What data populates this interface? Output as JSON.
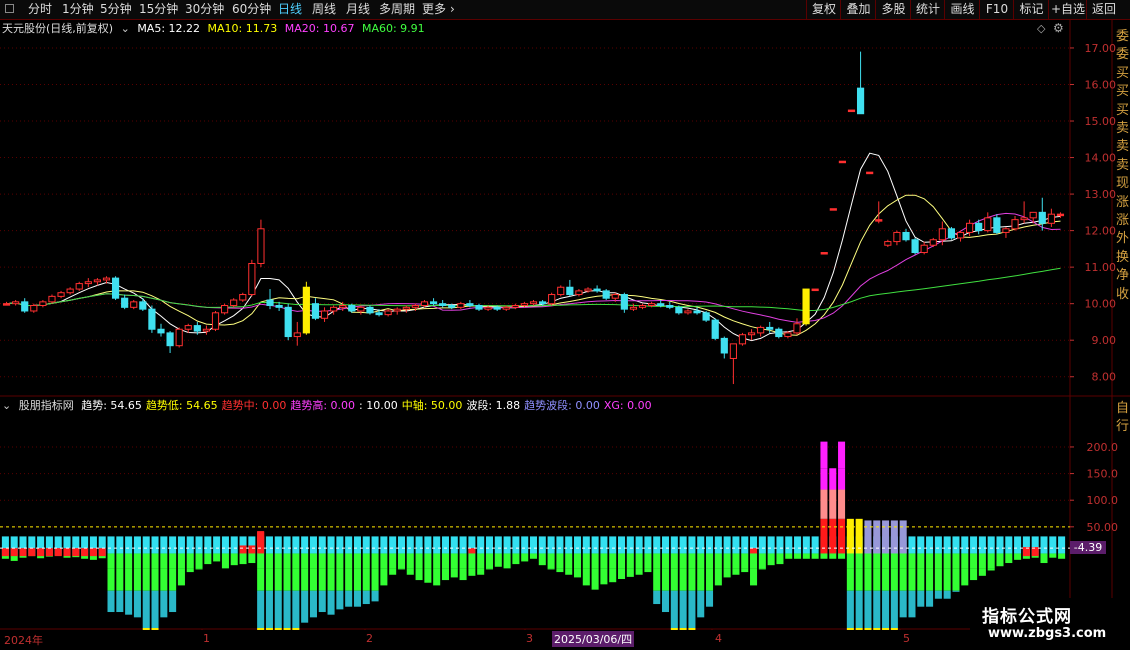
{
  "toolbar": {
    "periods": [
      "分时",
      "1分钟",
      "5分钟",
      "15分钟",
      "30分钟",
      "60分钟",
      "日线",
      "周线",
      "月线",
      "多周期",
      "更多"
    ],
    "active_period": "日线",
    "right_buttons": [
      "复权",
      "叠加",
      "多股",
      "统计",
      "画线",
      "F10",
      "标记",
      "+自选",
      "返回"
    ]
  },
  "main_info": {
    "stock": "天元股份(日线,前复权)",
    "ma5": "MA5: 12.22",
    "ma10": "MA10: 11.73",
    "ma20": "MA20: 10.67",
    "ma60": "MA60: 9.91"
  },
  "indicator_info": {
    "name": "股朋指标网",
    "items": [
      {
        "text": "趋势: 54.65",
        "color": "#ffffff"
      },
      {
        "text": "趋势低: 54.65",
        "color": "#ffff00"
      },
      {
        "text": "趋势中: 0.00",
        "color": "#ff3030"
      },
      {
        "text": "趋势高: 0.00",
        "color": "#ff40ff"
      },
      {
        "text": ": 10.00",
        "color": "#ffffff"
      },
      {
        "text": "中轴: 50.00",
        "color": "#ffff00"
      },
      {
        "text": "波段: 1.88",
        "color": "#ffffff"
      },
      {
        "text": "趋势波段: 0.00",
        "color": "#9090ff"
      },
      {
        "text": "XG: 0.00",
        "color": "#ff40ff"
      }
    ]
  },
  "price_axis": [
    "17.00",
    "16.00",
    "15.00",
    "14.00",
    "13.00",
    "12.00",
    "11.00",
    "10.00",
    "9.00",
    "8.00"
  ],
  "indicator_axis": [
    "200.0",
    "150.0",
    "100.0",
    "50.00"
  ],
  "indicator_value_tag": "-4.39",
  "date_axis": [
    "2024年",
    "1",
    "2",
    "3",
    "4",
    "5"
  ],
  "date_highlight": "2025/03/06/四",
  "watermark": {
    "title": "指标公式网",
    "url": "www.zbgs3.com"
  },
  "right_edge_text": [
    "委",
    "委",
    "买",
    "买",
    "买",
    "卖",
    "卖",
    "卖",
    "现",
    "涨",
    "涨",
    "外",
    "换",
    "净",
    "收"
  ],
  "right_edge_text_lower": [
    "自",
    "行"
  ],
  "colors": {
    "up": "#ff3030",
    "down": "#40e0f0",
    "limit_up": "#ffee00",
    "ma5": "#ffffff",
    "ma10": "#ffff80",
    "ma20": "#e040e0",
    "ma60": "#40e040",
    "grid": "#5a0000"
  },
  "chart_data": [
    {
      "type": "candlestick",
      "title": "天元股份(日线,前复权)",
      "ylim": [
        7.5,
        17.3
      ],
      "candles": [
        [
          10.0,
          10.05,
          9.95,
          10.0
        ],
        [
          10.0,
          10.1,
          9.95,
          10.05
        ],
        [
          10.05,
          10.15,
          9.75,
          9.8
        ],
        [
          9.8,
          10.0,
          9.75,
          9.95
        ],
        [
          9.95,
          10.1,
          9.9,
          10.05
        ],
        [
          10.05,
          10.25,
          10.0,
          10.2
        ],
        [
          10.2,
          10.35,
          10.15,
          10.3
        ],
        [
          10.3,
          10.45,
          10.25,
          10.4
        ],
        [
          10.4,
          10.6,
          10.35,
          10.55
        ],
        [
          10.55,
          10.7,
          10.45,
          10.6
        ],
        [
          10.6,
          10.7,
          10.5,
          10.65
        ],
        [
          10.65,
          10.75,
          10.55,
          10.7
        ],
        [
          10.7,
          10.75,
          10.1,
          10.15
        ],
        [
          10.15,
          10.25,
          9.85,
          9.9
        ],
        [
          9.9,
          10.1,
          9.85,
          10.05
        ],
        [
          10.05,
          10.15,
          9.8,
          9.85
        ],
        [
          9.85,
          9.95,
          9.2,
          9.3
        ],
        [
          9.3,
          9.45,
          9.1,
          9.2
        ],
        [
          9.2,
          9.25,
          8.65,
          8.85
        ],
        [
          8.85,
          9.35,
          8.8,
          9.3
        ],
        [
          9.3,
          9.45,
          9.2,
          9.4
        ],
        [
          9.4,
          9.5,
          9.15,
          9.25
        ],
        [
          9.25,
          9.4,
          9.15,
          9.3
        ],
        [
          9.3,
          9.8,
          9.25,
          9.75
        ],
        [
          9.75,
          10.0,
          9.7,
          9.95
        ],
        [
          9.95,
          10.15,
          9.9,
          10.1
        ],
        [
          10.1,
          10.3,
          10.05,
          10.25
        ],
        [
          10.25,
          11.2,
          10.2,
          11.1
        ],
        [
          11.1,
          12.3,
          11.0,
          12.05
        ],
        [
          10.1,
          10.4,
          9.85,
          9.95
        ],
        [
          9.95,
          10.05,
          9.8,
          9.9
        ],
        [
          9.9,
          10.0,
          9.0,
          9.1
        ],
        [
          9.1,
          9.5,
          8.85,
          9.2
        ],
        [
          9.2,
          10.6,
          9.15,
          10.45
        ],
        [
          10.0,
          10.15,
          9.55,
          9.6
        ],
        [
          9.6,
          9.9,
          9.5,
          9.8
        ],
        [
          9.8,
          9.95,
          9.7,
          9.9
        ],
        [
          9.9,
          10.05,
          9.8,
          9.95
        ],
        [
          9.95,
          10.0,
          9.75,
          9.8
        ],
        [
          9.8,
          9.95,
          9.7,
          9.9
        ],
        [
          9.9,
          9.95,
          9.7,
          9.75
        ],
        [
          9.75,
          9.85,
          9.65,
          9.7
        ],
        [
          9.7,
          9.85,
          9.65,
          9.8
        ],
        [
          9.8,
          9.9,
          9.7,
          9.85
        ],
        [
          9.85,
          9.95,
          9.75,
          9.9
        ],
        [
          9.9,
          10.0,
          9.8,
          9.95
        ],
        [
          9.95,
          10.1,
          9.9,
          10.05
        ],
        [
          10.05,
          10.15,
          9.95,
          10.0
        ],
        [
          10.0,
          10.1,
          9.9,
          9.95
        ],
        [
          9.95,
          10.0,
          9.85,
          9.9
        ],
        [
          9.9,
          10.05,
          9.85,
          10.0
        ],
        [
          10.0,
          10.1,
          9.9,
          9.95
        ],
        [
          9.95,
          10.0,
          9.8,
          9.85
        ],
        [
          9.85,
          9.95,
          9.8,
          9.9
        ],
        [
          9.9,
          9.95,
          9.8,
          9.85
        ],
        [
          9.85,
          9.95,
          9.8,
          9.9
        ],
        [
          9.9,
          10.0,
          9.85,
          9.95
        ],
        [
          9.95,
          10.05,
          9.9,
          10.0
        ],
        [
          10.0,
          10.1,
          9.95,
          10.05
        ],
        [
          10.05,
          10.1,
          9.95,
          10.0
        ],
        [
          10.0,
          10.3,
          9.95,
          10.25
        ],
        [
          10.25,
          10.5,
          10.2,
          10.45
        ],
        [
          10.45,
          10.65,
          10.2,
          10.25
        ],
        [
          10.25,
          10.4,
          10.2,
          10.35
        ],
        [
          10.35,
          10.45,
          10.3,
          10.4
        ],
        [
          10.4,
          10.5,
          10.3,
          10.35
        ],
        [
          10.35,
          10.4,
          10.1,
          10.15
        ],
        [
          10.15,
          10.3,
          10.05,
          10.25
        ],
        [
          10.25,
          10.3,
          9.75,
          9.85
        ],
        [
          9.85,
          10.0,
          9.8,
          9.9
        ],
        [
          9.9,
          10.0,
          9.85,
          9.95
        ],
        [
          9.95,
          10.05,
          9.9,
          10.0
        ],
        [
          10.0,
          10.1,
          9.9,
          9.95
        ],
        [
          9.95,
          10.05,
          9.85,
          9.9
        ],
        [
          9.9,
          9.95,
          9.7,
          9.75
        ],
        [
          9.75,
          9.85,
          9.7,
          9.8
        ],
        [
          9.8,
          9.9,
          9.7,
          9.75
        ],
        [
          9.75,
          9.8,
          9.5,
          9.55
        ],
        [
          9.55,
          9.6,
          9.0,
          9.05
        ],
        [
          9.05,
          9.1,
          8.5,
          8.65
        ],
        [
          8.5,
          8.8,
          7.8,
          8.9
        ],
        [
          8.9,
          9.2,
          8.85,
          9.15
        ],
        [
          9.15,
          9.3,
          9.0,
          9.2
        ],
        [
          9.2,
          9.4,
          9.1,
          9.35
        ],
        [
          9.35,
          9.5,
          9.2,
          9.3
        ],
        [
          9.3,
          9.35,
          9.05,
          9.1
        ],
        [
          9.1,
          9.25,
          9.05,
          9.2
        ],
        [
          9.2,
          9.6,
          9.15,
          9.45
        ],
        [
          9.45,
          9.9,
          9.4,
          10.4
        ],
        [
          10.4,
          10.4,
          10.4,
          10.4
        ],
        [
          11.4,
          11.4,
          11.4,
          11.4
        ],
        [
          12.6,
          12.6,
          12.6,
          12.6
        ],
        [
          13.9,
          13.9,
          13.9,
          13.9
        ],
        [
          15.3,
          15.3,
          15.3,
          15.3
        ],
        [
          15.9,
          16.9,
          15.2,
          15.2
        ],
        [
          13.6,
          13.6,
          13.6,
          13.6
        ],
        [
          12.3,
          12.8,
          12.2,
          12.3
        ],
        [
          11.6,
          11.75,
          11.55,
          11.7
        ],
        [
          11.7,
          12.0,
          11.6,
          11.95
        ],
        [
          11.95,
          12.05,
          11.7,
          11.75
        ],
        [
          11.75,
          11.8,
          11.35,
          11.4
        ],
        [
          11.4,
          11.7,
          11.35,
          11.6
        ],
        [
          11.6,
          11.8,
          11.55,
          11.75
        ],
        [
          11.75,
          12.25,
          11.6,
          12.05
        ],
        [
          12.05,
          12.1,
          11.75,
          11.8
        ],
        [
          11.8,
          12.0,
          11.7,
          11.95
        ],
        [
          11.95,
          12.3,
          11.85,
          12.2
        ],
        [
          12.2,
          12.3,
          11.9,
          12.0
        ],
        [
          12.0,
          12.5,
          11.95,
          12.35
        ],
        [
          12.35,
          12.45,
          11.9,
          11.95
        ],
        [
          11.95,
          12.1,
          11.8,
          12.05
        ],
        [
          12.05,
          12.4,
          12.0,
          12.3
        ],
        [
          12.3,
          12.8,
          12.2,
          12.35
        ],
        [
          12.35,
          12.5,
          12.2,
          12.5
        ],
        [
          12.5,
          12.9,
          12.0,
          12.2
        ],
        [
          12.2,
          12.6,
          12.1,
          12.45
        ],
        [
          12.45,
          12.5,
          12.35,
          12.45
        ]
      ]
    },
    {
      "type": "bar",
      "title": "股朋指标网",
      "ylim": [
        -140,
        260
      ],
      "series": [
        {
          "name": "波段",
          "values": [
            -10,
            -14,
            -8,
            -5,
            -9,
            -6,
            -4,
            -8,
            -7,
            -10,
            -12,
            -9,
            -110,
            -110,
            -115,
            -120,
            -160,
            -150,
            -120,
            -110,
            -60,
            -35,
            -30,
            -20,
            -15,
            -28,
            -22,
            -20,
            -18,
            -150,
            -160,
            -170,
            -170,
            -170,
            -130,
            -120,
            -110,
            -115,
            -105,
            -100,
            -100,
            -95,
            -90,
            -60,
            -40,
            -30,
            -40,
            -50,
            -55,
            -60,
            -50,
            -45,
            -50,
            -42,
            -40,
            -30,
            -25,
            -28,
            -20,
            -15,
            -10,
            -22,
            -30,
            -35,
            -40,
            -45,
            -60,
            -68,
            -58,
            -54,
            -48,
            -44,
            -40,
            -35,
            -95,
            -110,
            -150,
            -170,
            -150,
            -120,
            -100,
            -60,
            -45,
            -40,
            -35,
            -60,
            -30,
            -22,
            -20,
            -10,
            -10,
            -10,
            -10,
            -10,
            -10,
            -10,
            -145,
            -155,
            -160,
            -160,
            -160,
            -145,
            -120,
            -120,
            -100,
            -100,
            -85,
            -85,
            -72,
            -60,
            -50,
            -42,
            -32,
            -24,
            -18,
            -12,
            -10,
            -8,
            -18,
            -8,
            -10
          ]
        }
      ]
    }
  ]
}
